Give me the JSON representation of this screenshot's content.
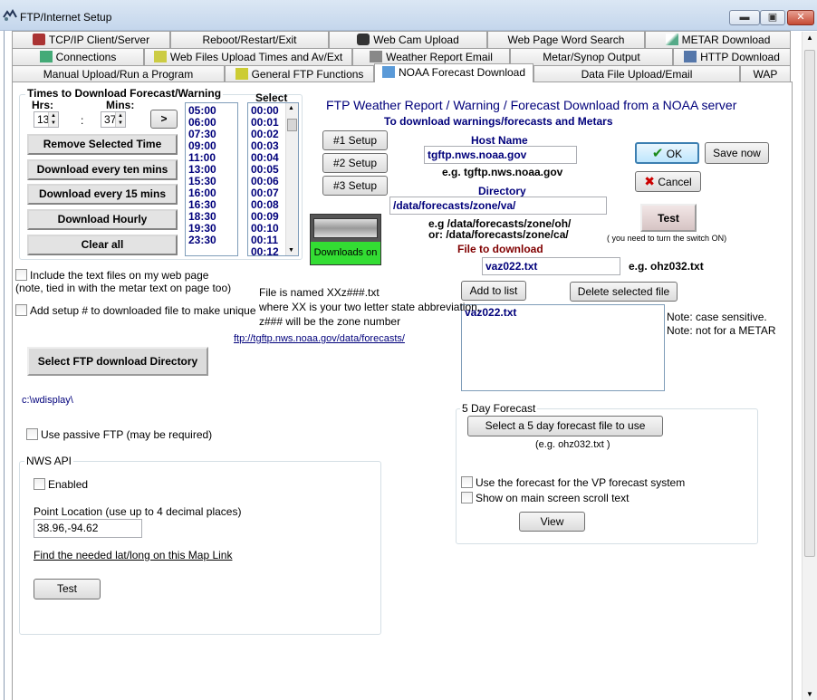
{
  "window": {
    "title": "FTP/Internet Setup",
    "min": "▬",
    "max": "▣",
    "close": "✕"
  },
  "tabs": {
    "row1": [
      "TCP/IP Client/Server",
      "Reboot/Restart/Exit",
      "Web Cam Upload",
      "Web Page Word Search",
      "METAR Download"
    ],
    "row2": [
      "Connections",
      "Web Files Upload Times and Av/Ext",
      "Weather Report Email",
      "Metar/Synop Output",
      "HTTP Download"
    ],
    "row3": [
      "Manual Upload/Run a Program",
      "General FTP Functions",
      "NOAA Forecast Download",
      "Data File Upload/Email",
      "WAP"
    ]
  },
  "times": {
    "legend": "Times to Download Forecast/Warning",
    "hrs_label": "Hrs:",
    "mins_label": "Mins:",
    "hrs_value": "13",
    "mins_value": "37",
    "colon": ":",
    "add_label": ">",
    "remove_label": "Remove Selected Time",
    "every10_label": "Download every ten mins",
    "every15_label": "Download every 15 mins",
    "hourly_label": "Download Hourly",
    "clear_label": "Clear all",
    "list": [
      "05:00",
      "06:00",
      "07:30",
      "09:00",
      "11:00",
      "13:00",
      "15:30",
      "16:00",
      "16:30",
      "18:30",
      "19:30",
      "23:30"
    ],
    "select_header": "Select",
    "select_list": [
      "00:00",
      "00:01",
      "00:02",
      "00:03",
      "00:04",
      "00:05",
      "00:06",
      "00:07",
      "00:08",
      "00:09",
      "00:10",
      "00:11",
      "00:12"
    ]
  },
  "setup": {
    "s1": "#1 Setup",
    "s2": "#2 Setup",
    "s3": "#3 Setup",
    "downloads_on": "Downloads on"
  },
  "header": {
    "title": "FTP Weather Report / Warning / Forecast Download from a NOAA server",
    "subtitle": "To download warnings/forecasts and Metars"
  },
  "host": {
    "label": "Host Name",
    "value": "tgftp.nws.noaa.gov",
    "eg": "e.g. tgftp.nws.noaa.gov"
  },
  "directory": {
    "label": "Directory",
    "value": "/data/forecasts/zone/va/",
    "eg1": "e.g /data/forecasts/zone/oh/",
    "eg2": "or:  /data/forecasts/zone/ca/"
  },
  "buttons": {
    "ok": "OK",
    "save_now": "Save now",
    "cancel": "Cancel",
    "test": "Test",
    "test_note": "( you need to turn the switch ON)"
  },
  "file": {
    "label": "File to download",
    "value": "vaz022.txt",
    "eg": "e.g. ohz032.txt",
    "add": "Add to list",
    "delete": "Delete selected file",
    "list": [
      "vaz022.txt"
    ],
    "note1": "Note: case sensitive.",
    "note2": "Note: not for a METAR"
  },
  "left": {
    "include_text": "Include the text files on my web page",
    "include_note": "(note, tied in with the metar text on page too)",
    "add_setup": "Add setup # to downloaded file to make unique",
    "file_named1": "File is named XXz###.txt",
    "file_named2": "where XX is your two letter state abbreviation,",
    "file_named3": "z### will be the zone number",
    "ftp_link": "ftp://tgftp.nws.noaa.gov/data/forecasts/",
    "select_dir": "Select FTP download  Directory",
    "dir_path": "c:\\wdisplay\\",
    "passive": "Use passive FTP (may be required)"
  },
  "nws": {
    "legend": "NWS API",
    "enabled": "Enabled",
    "point_label": "Point Location (use up to 4 decimal places)",
    "point_value": "38.96,-94.62",
    "map_link": "Find the needed lat/long on this Map Link",
    "test": "Test"
  },
  "five_day": {
    "legend": "5 Day Forecast",
    "select": "Select a 5 day forecast file to use",
    "eg": "(e.g. ohz032.txt )",
    "vp": "Use the forecast for the VP forecast system",
    "scroll": "Show on main screen scroll text",
    "view": "View"
  }
}
